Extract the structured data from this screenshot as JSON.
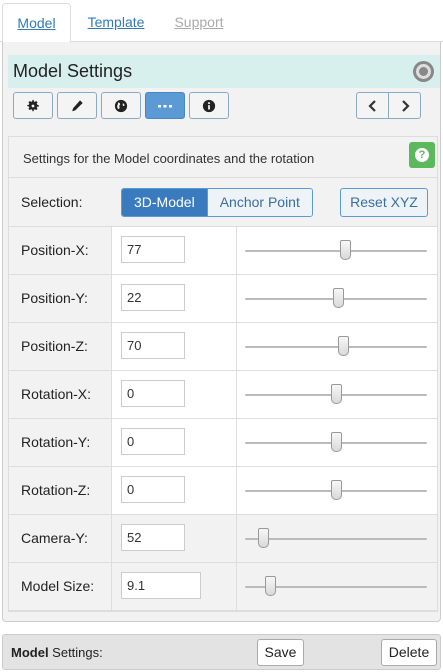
{
  "tabs": [
    {
      "label": "Model",
      "active": true
    },
    {
      "label": "Template",
      "active": false
    },
    {
      "label": "Support",
      "active": false
    }
  ],
  "panel": {
    "title": "Model Settings",
    "toolbar_icons": [
      "gear-icon",
      "pencil-icon",
      "globe-icon",
      "ellipsis-icon",
      "info-icon"
    ],
    "active_tool": "ellipsis-icon",
    "nav_prev": "‹",
    "nav_next": "›"
  },
  "settings": {
    "description": "Settings for the Model coordinates and the rotation",
    "help_label": "?",
    "selection": {
      "label": "Selection:",
      "options": [
        "3D-Model",
        "Anchor Point"
      ],
      "selected": "3D-Model",
      "reset_label": "Reset XYZ"
    },
    "rows": [
      {
        "label": "Position-X:",
        "value": "77",
        "slider_fraction": 0.55
      },
      {
        "label": "Position-Y:",
        "value": "22",
        "slider_fraction": 0.51
      },
      {
        "label": "Position-Z:",
        "value": "70",
        "slider_fraction": 0.54
      },
      {
        "label": "Rotation-X:",
        "value": "0",
        "slider_fraction": 0.5
      },
      {
        "label": "Rotation-Y:",
        "value": "0",
        "slider_fraction": 0.5
      },
      {
        "label": "Rotation-Z:",
        "value": "0",
        "slider_fraction": 0.5
      },
      {
        "label": "Camera-Y:",
        "value": "52",
        "slider_fraction": 0.1
      },
      {
        "label": "Model Size:",
        "value": "9.1",
        "slider_fraction": 0.14
      }
    ]
  },
  "footer": {
    "label_bold": "Model",
    "label_rest": " Settings:",
    "save_label": "Save",
    "delete_label": "Delete"
  },
  "colors": {
    "accent": "#3a7bc0",
    "header_bg": "#d7f0ee",
    "help_green": "#5cb85c"
  }
}
